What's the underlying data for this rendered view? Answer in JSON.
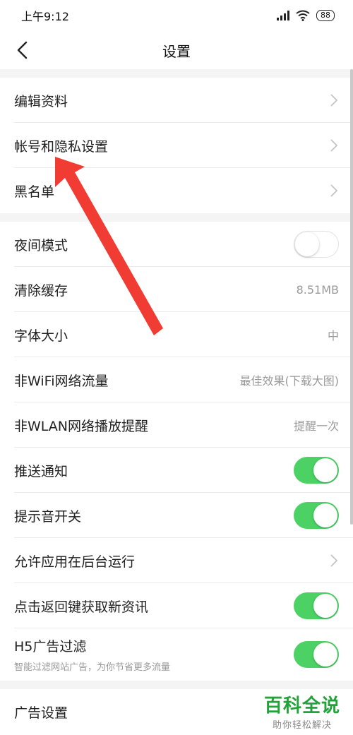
{
  "status_bar": {
    "time": "上午9:12",
    "battery": "88"
  },
  "nav": {
    "title": "设置"
  },
  "group1": [
    {
      "label": "编辑资料"
    },
    {
      "label": "帐号和隐私设置"
    },
    {
      "label": "黑名单"
    }
  ],
  "group2": {
    "night_mode": {
      "label": "夜间模式",
      "enabled": false
    },
    "clear_cache": {
      "label": "清除缓存",
      "value": "8.51MB"
    },
    "font_size": {
      "label": "字体大小",
      "value": "中"
    },
    "non_wifi": {
      "label": "非WiFi网络流量",
      "value": "最佳效果(下载大图)"
    },
    "non_wlan": {
      "label": "非WLAN网络播放提醒",
      "value": "提醒一次"
    },
    "push": {
      "label": "推送通知",
      "enabled": true
    },
    "sound": {
      "label": "提示音开关",
      "enabled": true
    },
    "background_run": {
      "label": "允许应用在后台运行"
    },
    "back_refresh": {
      "label": "点击返回键获取新资讯",
      "enabled": true
    },
    "h5_filter": {
      "label": "H5广告过滤",
      "sublabel": "智能过滤网站广告，为你节省更多流量",
      "enabled": true
    }
  },
  "group3": [
    {
      "label": "广告设置"
    }
  ],
  "watermark": {
    "title": "百科全说",
    "subtitle": "助你轻松解决"
  },
  "colors": {
    "toggle_on": "#4cd264",
    "annotation_arrow": "#f03c32",
    "watermark_green": "#22a33a"
  }
}
